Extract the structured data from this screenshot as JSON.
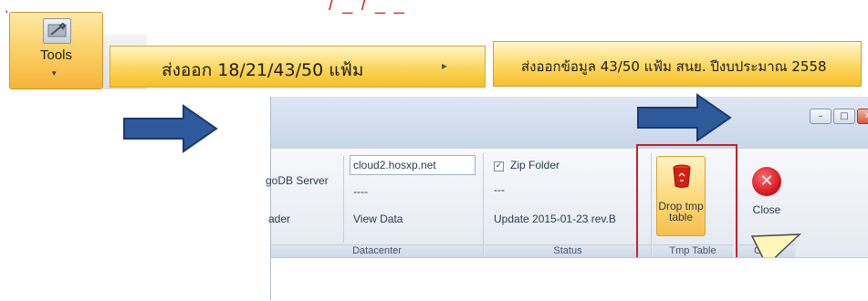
{
  "top": {
    "left_mark": "ุ",
    "red_text": "/ _ / _ _"
  },
  "tools": {
    "label": "Tools",
    "chevron": "▾",
    "icon": "tools-icon"
  },
  "menu": {
    "item1_label": "ส่งออก 18/21/43/50 แฟ้ม",
    "item1_arrow": "▸",
    "item2_label": "ส่งออกข้อมูล 43/50 แฟ้ม สนย. ปีงบประมาณ 2558"
  },
  "window": {
    "controls": {
      "minimize": "–",
      "maximize": "□",
      "close": "✕"
    }
  },
  "ribbon": {
    "datacenter": {
      "mongodb_label": "goDB Server",
      "server_value": "cloud2.hosxp.net",
      "dash": "----",
      "reader_label": "ader",
      "view_data_label": "View Data",
      "group_label": "Datacenter"
    },
    "status": {
      "zip_label": "Zip Folder",
      "zip_checked": true,
      "dash": "---",
      "update_label": "Update 2015-01-23 rev.B",
      "group_label": "Status"
    },
    "tmp_table": {
      "drop_label": "Drop tmp table",
      "group_label": "Tmp Table"
    },
    "close_group": {
      "close_label": "Close",
      "group_label": "Close"
    }
  },
  "colors": {
    "highlight": "#c8202a",
    "arrow_fill": "#2e5a9c",
    "menu_gold": "#fbd55b"
  }
}
